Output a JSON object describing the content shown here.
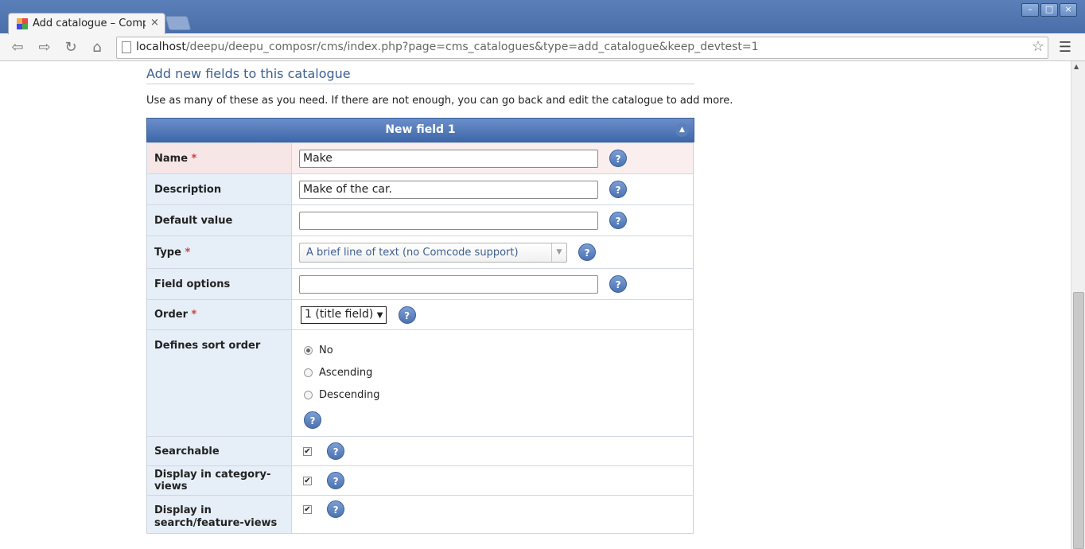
{
  "browser": {
    "tab_title": "Add catalogue – Compo",
    "url_host": "localhost",
    "url_path": "/deepu/deepu_composr/cms/index.php?page=cms_catalogues&type=add_catalogue&keep_devtest=1",
    "icons": [
      "back-icon",
      "forward-icon",
      "reload-icon",
      "home-icon",
      "page-icon",
      "star-icon",
      "menu-icon",
      "close-tab-icon"
    ]
  },
  "page": {
    "section_title": "Add new fields to this catalogue",
    "intro": "Use as many of these as you need. If there are not enough, you can go back and edit the catalogue to add more.",
    "form_title": "New field 1",
    "help_glyph": "?",
    "required_mark": "*"
  },
  "fields": {
    "name": {
      "label": "Name",
      "value": "Make"
    },
    "description": {
      "label": "Description",
      "value": "Make of the car."
    },
    "default_value": {
      "label": "Default value",
      "value": ""
    },
    "type": {
      "label": "Type",
      "value": "A brief line of text (no Comcode support)"
    },
    "field_options": {
      "label": "Field options",
      "value": ""
    },
    "order": {
      "label": "Order",
      "value": "1 (title field)"
    },
    "sort_order": {
      "label": "Defines sort order",
      "options": [
        "No",
        "Ascending",
        "Descending"
      ],
      "selected": "No"
    },
    "searchable": {
      "label": "Searchable",
      "checked": true
    },
    "category_views": {
      "label": "Display in category-views",
      "checked": true
    },
    "search_views": {
      "label": "Display in search/feature-views",
      "checked": true
    }
  },
  "colors": {
    "accent": "#3d5f92",
    "header_bg": "#4f76b6",
    "label_bg": "#e6eef8",
    "required": "#d04040"
  }
}
